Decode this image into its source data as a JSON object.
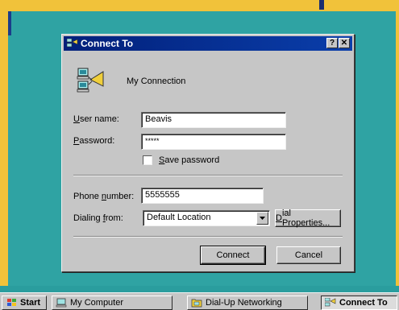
{
  "dialog": {
    "title": "Connect To",
    "help_button": "?",
    "close_button": "✕",
    "connection_name": "My Connection",
    "username_label_ul": "U",
    "username_label_rest": "ser name:",
    "username_value": "Beavis",
    "password_label_ul": "P",
    "password_label_rest": "assword:",
    "password_value": "*****",
    "save_password_ul": "S",
    "save_password_rest": "ave password",
    "save_password_checked": false,
    "phone_label_pre": "Phone ",
    "phone_label_ul": "n",
    "phone_label_rest": "umber:",
    "phone_value": "5555555",
    "dialing_label_pre": "Dialing ",
    "dialing_label_ul": "f",
    "dialing_label_rest": "rom:",
    "dialing_value": "Default Location",
    "dial_props_ul": "D",
    "dial_props_rest": "ial Properties...",
    "connect_label": "Connect",
    "cancel_label": "Cancel"
  },
  "taskbar": {
    "start_label": "Start",
    "items": [
      {
        "label": "My Computer",
        "active": false
      },
      {
        "label": "Dial-Up Networking",
        "active": false
      },
      {
        "label": "Connect To",
        "active": true
      }
    ]
  },
  "colors": {
    "desktop": "#2fa3a3",
    "frame": "#f1c23a",
    "titlebar": "#02207a",
    "face": "#c6c6c6"
  },
  "icons": [
    "connection-icon",
    "dialup-icon",
    "computer-icon",
    "windows-flag-icon",
    "dropdown-arrow-icon"
  ]
}
